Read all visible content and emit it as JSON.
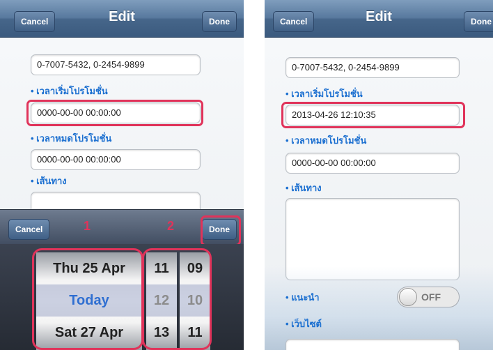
{
  "left": {
    "nav": {
      "cancel": "Cancel",
      "title": "Edit",
      "done": "Done"
    },
    "labels": {
      "start": "เวลาเริ่มโปรโมชั่น",
      "end": "เวลาหมดโปรโมชั่น",
      "route": "เส้นทาง"
    },
    "fields": {
      "phone": "0-7007-5432, 0-2454-9899",
      "start": "0000-00-00 00:00:00",
      "end": "0000-00-00 00:00:00"
    },
    "picker": {
      "cancel": "Cancel",
      "done": "Done",
      "dates": [
        "Thu 25 Apr",
        "Today",
        "Sat 27 Apr"
      ],
      "hours": [
        "11",
        "12",
        "13"
      ],
      "minutes": [
        "09",
        "10",
        "11"
      ]
    },
    "markers": [
      "1",
      "2"
    ]
  },
  "right": {
    "nav": {
      "cancel": "Cancel",
      "title": "Edit",
      "done": "Done"
    },
    "labels": {
      "start": "เวลาเริ่มโปรโมชั่น",
      "end": "เวลาหมดโปรโมชั่น",
      "route": "เส้นทาง",
      "recommend": "แนะนำ",
      "website": "เว็บไซต์"
    },
    "fields": {
      "phone": "0-7007-5432, 0-2454-9899",
      "start": "2013-04-26 12:10:35",
      "end": "0000-00-00 00:00:00"
    },
    "toggle": {
      "state": "OFF"
    }
  },
  "colors": {
    "highlight": "#e0335a",
    "navbar": "#4a6b91",
    "label": "#1b6fd0",
    "picker_selected": "#2f6fd1"
  }
}
